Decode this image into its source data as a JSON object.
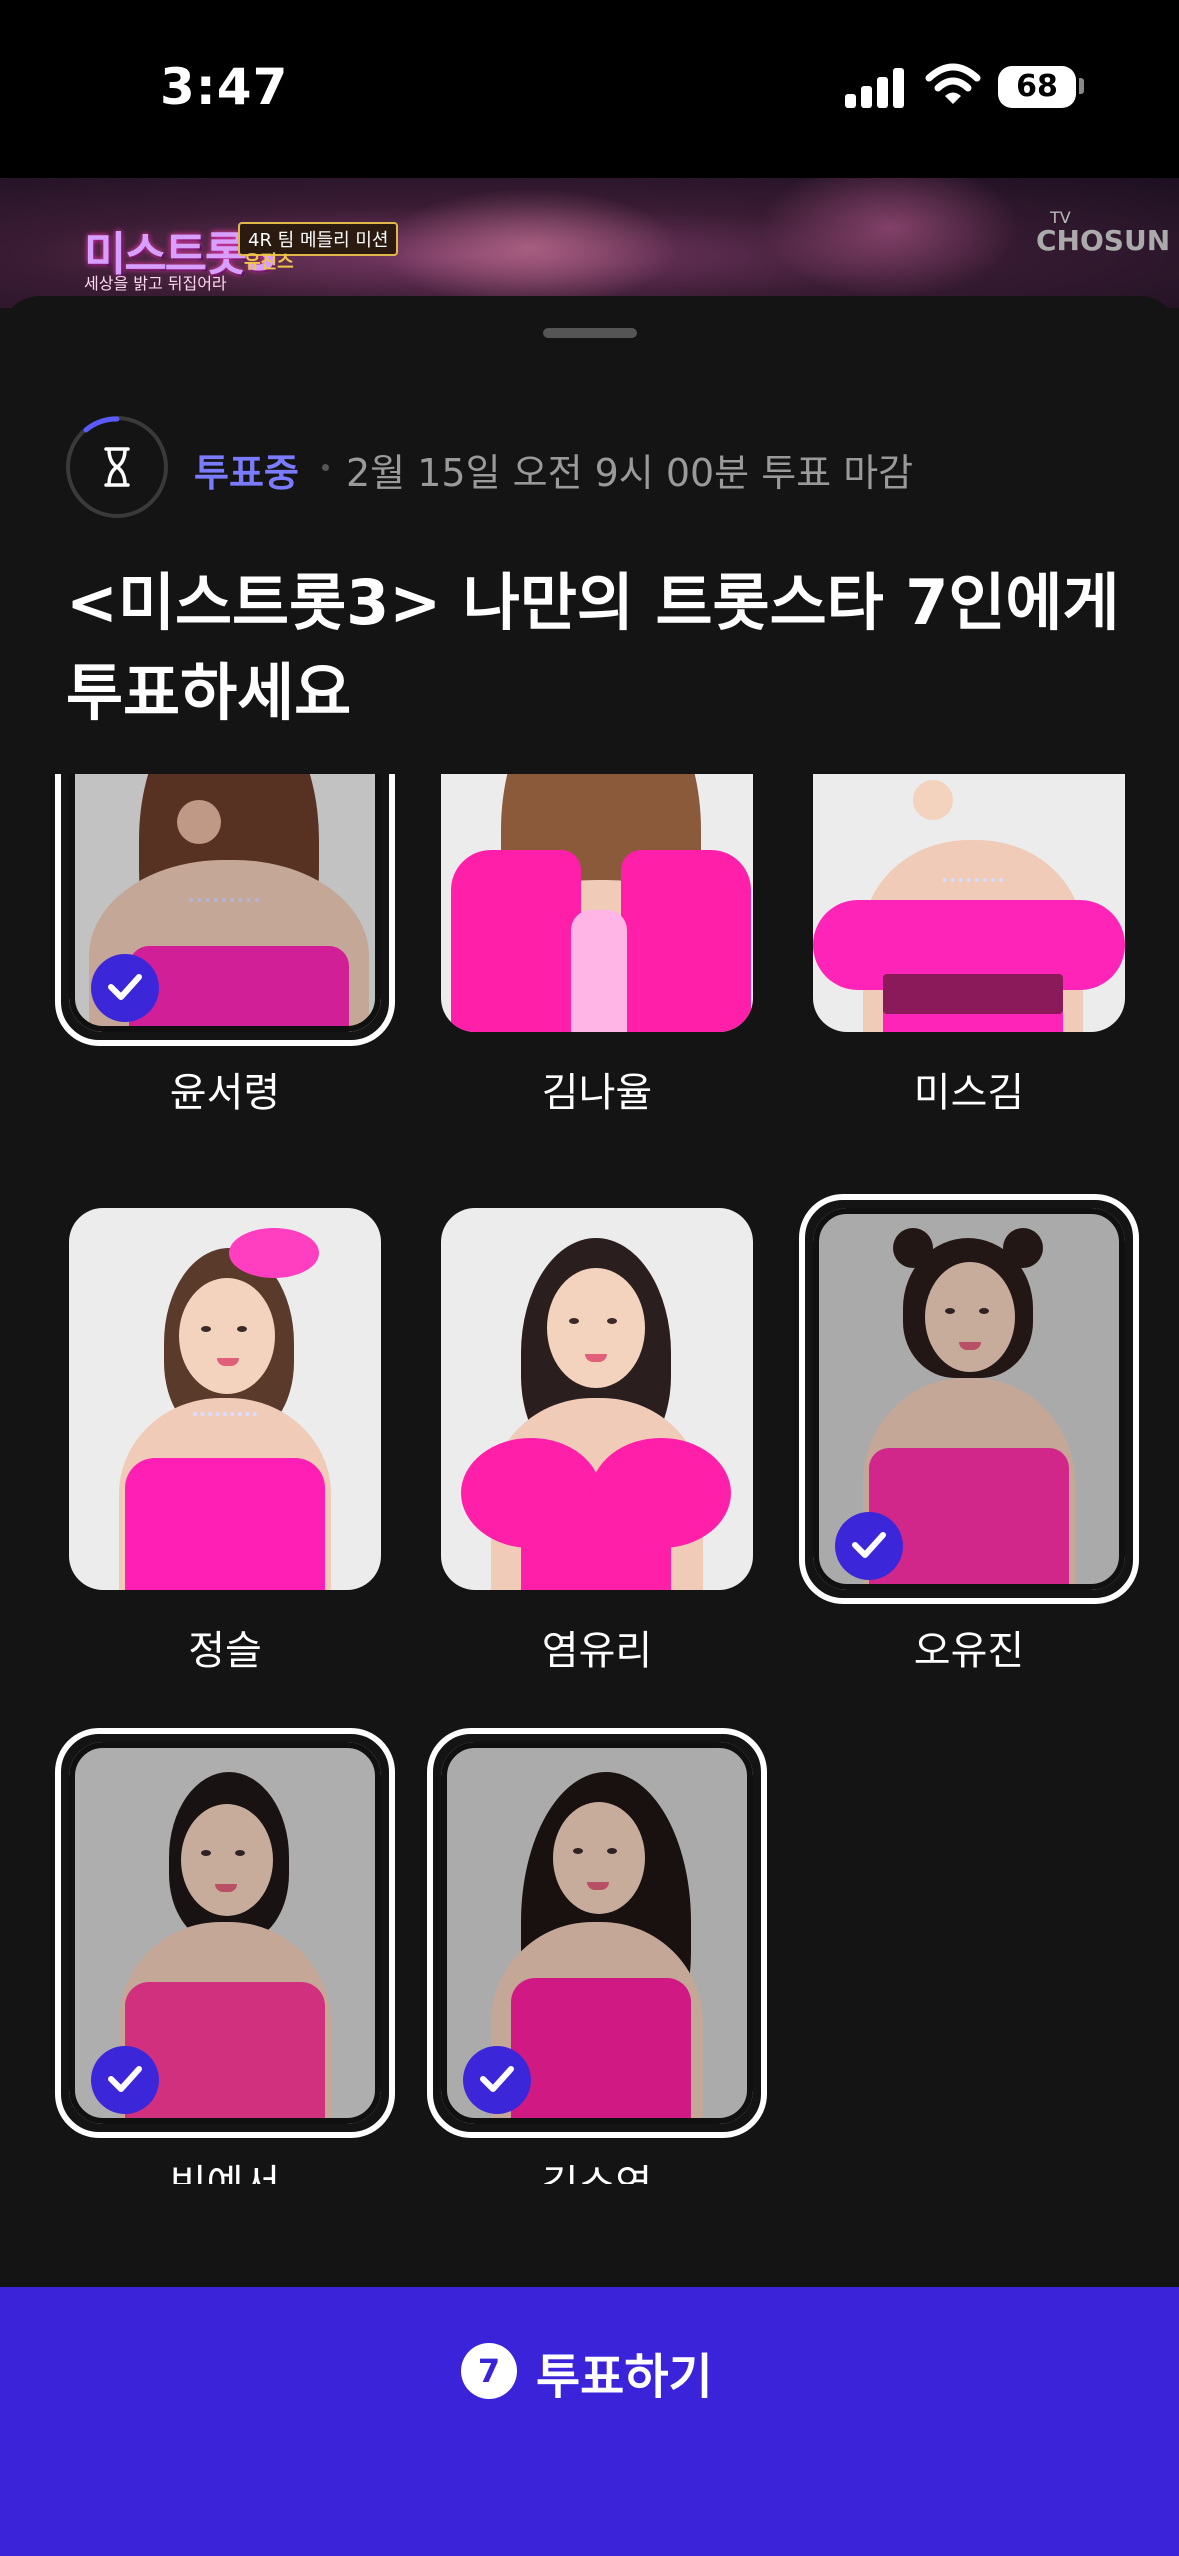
{
  "status_bar": {
    "time": "3:47",
    "battery": "68",
    "icons": [
      "signal-icon",
      "wifi-icon",
      "battery-icon"
    ]
  },
  "video": {
    "logo": "미스트롯3",
    "logo_sub": "세상을 밝고 뒤집어라",
    "mission": "4R 팀 메들리 미션",
    "team": "유진스",
    "channel_small": "TV",
    "channel": "CHOSUN"
  },
  "vote": {
    "status": "투표중",
    "deadline": "2월 15일 오전 9시 00분 투표 마감",
    "title": "<미스트롯3> 나만의 트롯스타 7인에게 투표하세요"
  },
  "candidates": [
    {
      "name": "윤서령",
      "selected": true
    },
    {
      "name": "김나율",
      "selected": false
    },
    {
      "name": "미스김",
      "selected": false
    },
    {
      "name": "정슬",
      "selected": false
    },
    {
      "name": "염유리",
      "selected": false
    },
    {
      "name": "오유진",
      "selected": true
    },
    {
      "name": "빈예서",
      "selected": true
    },
    {
      "name": "김소연",
      "selected": true
    }
  ],
  "submit": {
    "count": "7",
    "label": "투표하기"
  },
  "colors": {
    "accent": "#3a23d9",
    "status_text": "#7b7bff",
    "dress_pink": "#ff1fb4"
  }
}
